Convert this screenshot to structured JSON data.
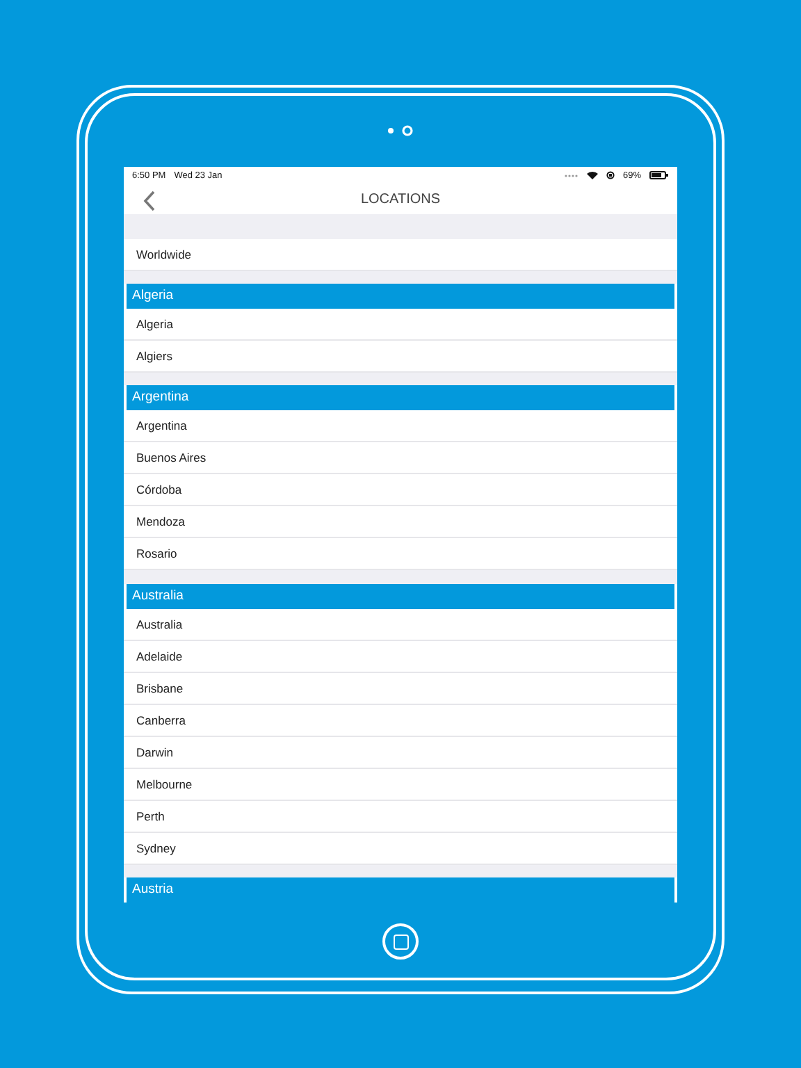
{
  "status_bar": {
    "time": "6:50 PM",
    "date": "Wed 23 Jan",
    "battery": "69%"
  },
  "nav": {
    "title": "LOCATIONS"
  },
  "sections": [
    {
      "items": [
        "Worldwide"
      ]
    },
    {
      "header": "Algeria",
      "items": [
        "Algeria",
        "Algiers"
      ]
    },
    {
      "header": "Argentina",
      "items": [
        "Argentina",
        "Buenos Aires",
        "Córdoba",
        "Mendoza",
        "Rosario"
      ]
    },
    {
      "header": "Australia",
      "items": [
        "Australia",
        "Adelaide",
        "Brisbane",
        "Canberra",
        "Darwin",
        "Melbourne",
        "Perth",
        "Sydney"
      ]
    },
    {
      "header": "Austria"
    }
  ]
}
